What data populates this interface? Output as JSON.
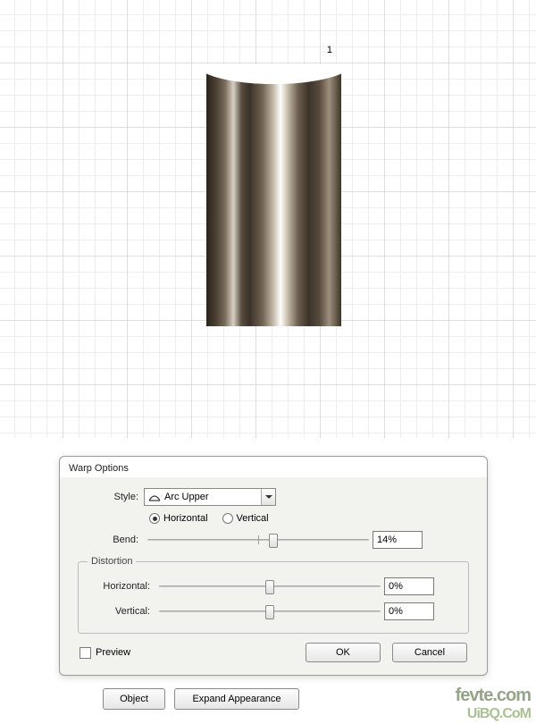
{
  "canvas": {
    "object_caption": "1"
  },
  "dialog": {
    "title": "Warp Options",
    "style_label": "Style:",
    "style_icon": "arc-upper-icon",
    "style_value": "Arc Upper",
    "orientation": {
      "horizontal_label": "Horizontal",
      "vertical_label": "Vertical",
      "selected": "horizontal"
    },
    "bend": {
      "label": "Bend:",
      "value": "14%",
      "position_pct": 57
    },
    "distortion": {
      "legend": "Distortion",
      "horizontal": {
        "label": "Horizontal:",
        "value": "0%",
        "position_pct": 50
      },
      "vertical": {
        "label": "Vertical:",
        "value": "0%",
        "position_pct": 50
      }
    },
    "preview_label": "Preview",
    "preview_checked": false,
    "ok_label": "OK",
    "cancel_label": "Cancel"
  },
  "footer_buttons": {
    "object": "Object",
    "expand": "Expand Appearance"
  },
  "watermark": {
    "line1": "fevte.com",
    "line2": "UiBQ.CoM"
  }
}
